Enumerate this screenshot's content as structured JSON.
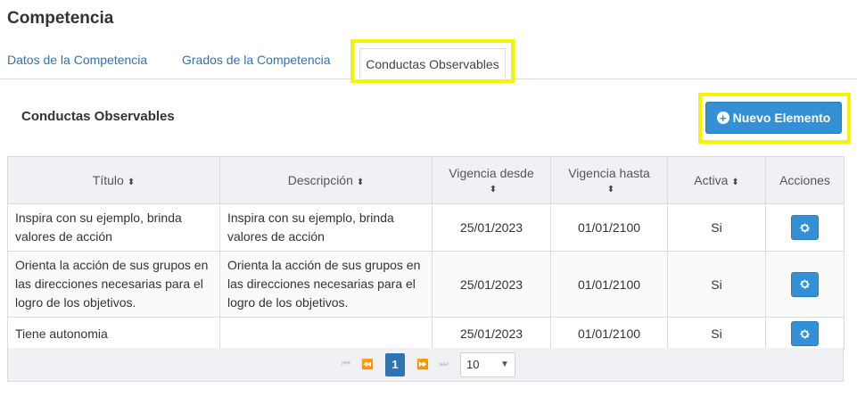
{
  "page_title": "Competencia",
  "tabs": [
    {
      "label": "Datos de la Competencia"
    },
    {
      "label": "Grados de la Competencia"
    },
    {
      "label": "Conductas Observables"
    }
  ],
  "section_title": "Conductas Observables",
  "new_button_label": "Nuevo Elemento",
  "table": {
    "headers": {
      "titulo": "Título",
      "descripcion": "Descripción",
      "vigencia_desde": "Vigencia desde",
      "vigencia_hasta": "Vigencia hasta",
      "activa": "Activa",
      "acciones": "Acciones"
    },
    "rows": [
      {
        "titulo": "Inspira con su ejemplo, brinda valores de acción",
        "descripcion": "Inspira con su ejemplo, brinda valores de acción",
        "vigencia_desde": "25/01/2023",
        "vigencia_hasta": "01/01/2100",
        "activa": "Si"
      },
      {
        "titulo": "Orienta la acción de sus grupos en las direcciones necesarias para el logro de los objetivos.",
        "descripcion": "Orienta la acción de sus grupos en las direcciones necesarias para el logro de los objetivos.",
        "vigencia_desde": "25/01/2023",
        "vigencia_hasta": "01/01/2100",
        "activa": "Si"
      },
      {
        "titulo": "Tiene autonomia",
        "descripcion": "",
        "vigencia_desde": "25/01/2023",
        "vigencia_hasta": "01/01/2100",
        "activa": "Si"
      }
    ]
  },
  "pager": {
    "current_page": "1",
    "page_size": "10"
  },
  "colors": {
    "primary": "#3390d4",
    "highlight": "#f5f500",
    "link": "#2f73b4"
  }
}
